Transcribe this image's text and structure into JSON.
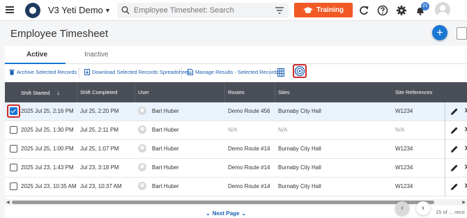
{
  "app": {
    "title": "V3 Yeti Demo"
  },
  "search": {
    "placeholder": "Employee Timesheet: Search"
  },
  "training": {
    "label": "Training"
  },
  "notifications": {
    "count": "21"
  },
  "page": {
    "title": "Employee Timesheet"
  },
  "fab": {
    "label": "+"
  },
  "tabs": [
    {
      "label": "Active"
    },
    {
      "label": "Inactive"
    }
  ],
  "toolbar": {
    "archive": "Archive Selected Records",
    "download": "Download Selected Records Spreadsheet",
    "manage": "Manage Results - Selected Records"
  },
  "table": {
    "columns": [
      "Shift Started",
      "Shift Completed",
      "User",
      "Routes",
      "Sites",
      "Site References"
    ],
    "sort_arrow": "↓",
    "rows": [
      {
        "started": "2025 Jul 25, 2:16 PM",
        "completed": "Jul 25, 2:20 PM",
        "user": "Bart Huber",
        "route": "Demo Route 456",
        "site": "Burnaby City Hall",
        "ref": "W1234",
        "checked": true
      },
      {
        "started": "2025 Jul 25, 1:30 PM",
        "completed": "Jul 25, 2:11 PM",
        "user": "Bart Huber",
        "route": "N/A",
        "site": "N/A",
        "ref": "N/A",
        "checked": false
      },
      {
        "started": "2025 Jul 25, 1:00 PM",
        "completed": "Jul 25, 1:07 PM",
        "user": "Bart Huber",
        "route": "Demo Route #14",
        "site": "Burnaby City Hall",
        "ref": "W1234",
        "checked": false
      },
      {
        "started": "2025 Jul 23, 1:43 PM",
        "completed": "Jul 23, 3:18 PM",
        "user": "Bart Huber",
        "route": "Demo Route #14",
        "site": "Burnaby City Hall",
        "ref": "W1234",
        "checked": false
      },
      {
        "started": "2025 Jul 23, 10:35 AM",
        "completed": "Jul 23, 10:37 AM",
        "user": "Bart Huber",
        "route": "Demo Route #14",
        "site": "Burnaby City Hall",
        "ref": "W1234",
        "checked": false
      }
    ]
  },
  "pagination": {
    "next_label": "Next Page",
    "prev": "‹",
    "next": "›",
    "count_text": "15 of ... reco"
  },
  "colors": {
    "accent": "#1976d2",
    "training": "#f15a24",
    "header": "#4a4e57",
    "highlight": "#d12b2b"
  }
}
